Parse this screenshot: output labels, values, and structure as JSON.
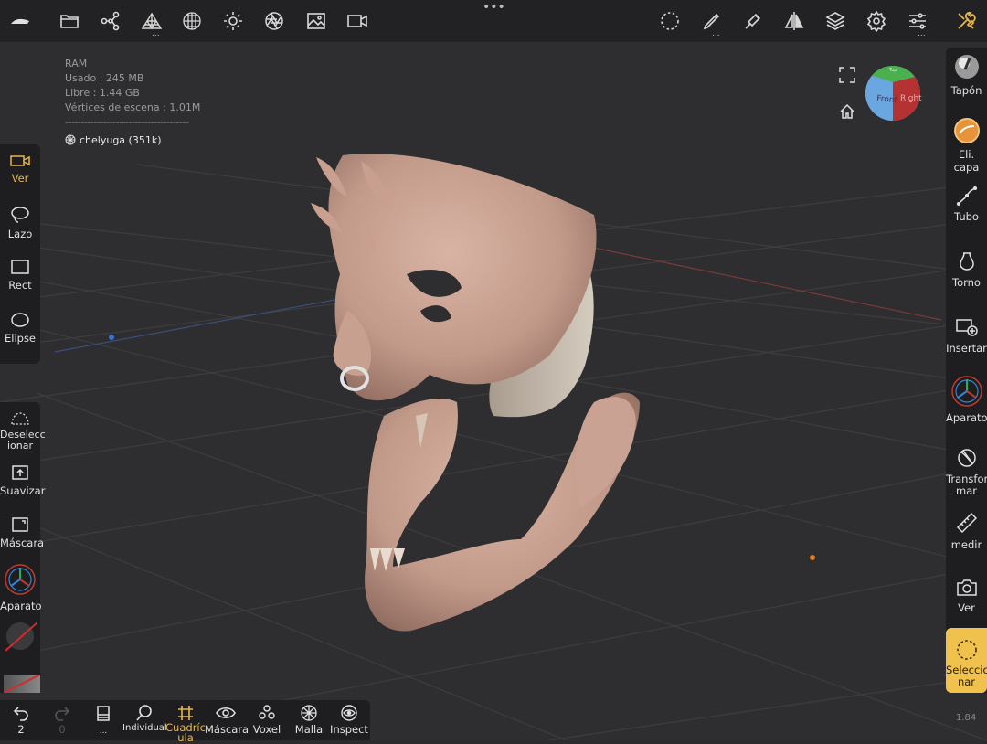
{
  "stats": {
    "ram_label": "RAM",
    "used": "Usado : 245 MB",
    "free": "Libre : 1.44 GB",
    "vertices": "Vértices de escena : 1.01M",
    "separator": "---------------------------------------",
    "object": "chelyuga (351k)"
  },
  "top_toolbar": {
    "icons": [
      "nomad-logo",
      "folder-icon",
      "scene-graph-icon",
      "topology-icon",
      "material-sphere-icon",
      "light-icon",
      "camera-aperture-icon",
      "image-icon",
      "video-camera-icon",
      "lasso-select-icon",
      "brush-icon",
      "paint-icon",
      "symmetry-icon",
      "layers-icon",
      "settings-icon",
      "sliders-icon",
      "tools-icon"
    ],
    "more": "..."
  },
  "view_cube": {
    "front": "Front",
    "right": "Right",
    "top": "Top"
  },
  "left_tools": [
    {
      "name": "ver",
      "label": "Ver"
    },
    {
      "name": "lazo",
      "label": "Lazo"
    },
    {
      "name": "rect",
      "label": "Rect"
    },
    {
      "name": "elipse",
      "label": "Elipse"
    }
  ],
  "left_actions": [
    {
      "name": "deseleccionar",
      "label": "Deselecc ionar"
    },
    {
      "name": "suavizar",
      "label": "Suavizar"
    },
    {
      "name": "mascara",
      "label": "Máscara"
    },
    {
      "name": "aparato",
      "label": "Aparato"
    }
  ],
  "right_tools": [
    {
      "name": "tapon",
      "label": "Tapón"
    },
    {
      "name": "eli-capa",
      "label": "Eli. capa"
    },
    {
      "name": "tubo",
      "label": "Tubo"
    },
    {
      "name": "torno",
      "label": "Torno"
    },
    {
      "name": "insertar",
      "label": "Insertar"
    },
    {
      "name": "aparato",
      "label": "Aparato"
    },
    {
      "name": "transformar",
      "label": "Transfor mar"
    },
    {
      "name": "medir",
      "label": "medir"
    },
    {
      "name": "ver",
      "label": "Ver"
    },
    {
      "name": "seleccionar",
      "label": "Seleccio nar"
    }
  ],
  "bottom": {
    "undo_count": "2",
    "redo_count": "0",
    "more": "...",
    "tools": [
      {
        "name": "individual",
        "label": "Individual"
      },
      {
        "name": "cuadricula",
        "label": "Cuadríc ula"
      },
      {
        "name": "mascara",
        "label": "Máscara"
      },
      {
        "name": "voxel",
        "label": "Voxel"
      },
      {
        "name": "malla",
        "label": "Malla"
      },
      {
        "name": "inspect",
        "label": "Inspect"
      }
    ]
  },
  "version": "1.84",
  "colors": {
    "accent": "#e8b64c",
    "active_panel": "#f0c24d",
    "background": "#2c2c2e",
    "toolbar": "#222224",
    "model": "#c9a394"
  }
}
